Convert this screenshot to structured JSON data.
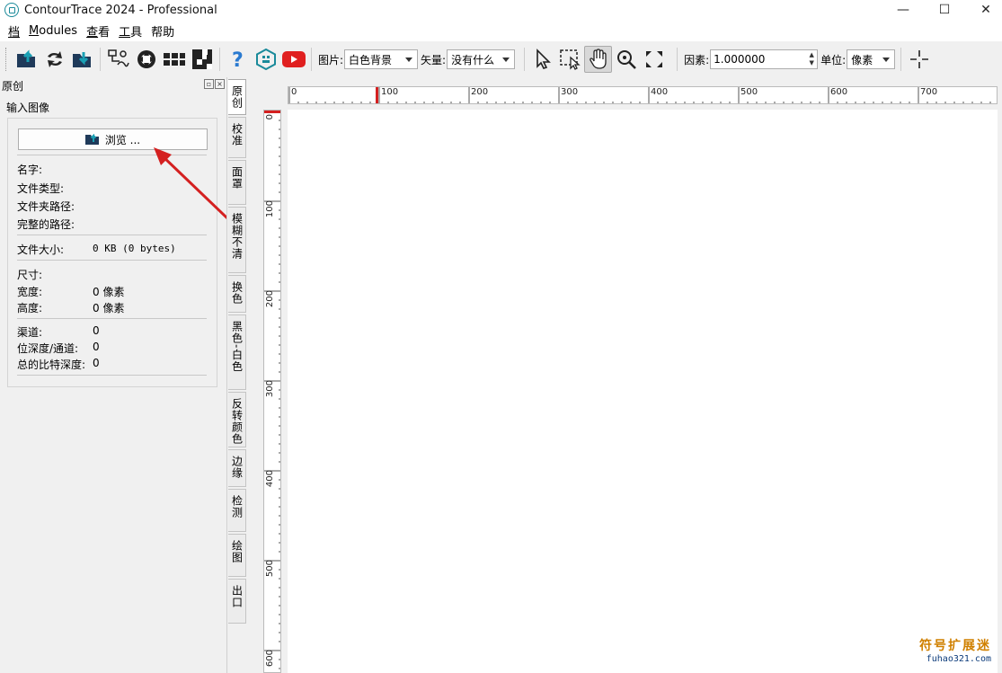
{
  "window": {
    "title": "ContourTrace 2024 - Professional",
    "controls": {
      "minimize": "—",
      "maximize": "☐",
      "close": "✕"
    }
  },
  "menu": [
    {
      "label": "档",
      "underline": "档",
      "rest": ""
    },
    {
      "label": "Modules",
      "underline": "M",
      "rest": "odules"
    },
    {
      "label": "查看",
      "underline": "查",
      "rest": "看"
    },
    {
      "label": "工具",
      "underline": "工",
      "rest": "具"
    },
    {
      "label": "帮助",
      "underline": "",
      "rest": "帮助"
    }
  ],
  "toolbar": {
    "icons": [
      "open-file-icon",
      "refresh-icon",
      "save-file-icon",
      "trace-icon",
      "circle-icon",
      "grid-icon",
      "checker-icon",
      "help-icon",
      "logo-icon",
      "youtube-icon"
    ],
    "image_label": "图片:",
    "image_value": "白色背景",
    "vector_label": "矢量:",
    "vector_value": "没有什么",
    "tools": [
      "pointer-icon",
      "select-region-icon",
      "hand-icon",
      "zoom-icon",
      "fit-icon"
    ],
    "factor_label": "因素:",
    "factor_value": "1.000000",
    "unit_label": "单位:",
    "unit_value": "像素",
    "crosshair": "crosshair-icon"
  },
  "panel": {
    "header": "原创",
    "section": "输入图像",
    "browse_label": "浏览 ...",
    "name_label": "名字:",
    "filetype_label": "文件类型:",
    "folder_label": "文件夹路径:",
    "fullpath_label": "完整的路径:",
    "filesize_label": "文件大小:",
    "filesize_value": "0 KB (0 bytes)",
    "size_label": "尺寸:",
    "width_label": "宽度:",
    "width_value": "0 像素",
    "height_label": "高度:",
    "height_value": "0 像素",
    "channels_label": "渠道:",
    "channels_value": "0",
    "bitdepth_label": "位深度/通道:",
    "bitdepth_value": "0",
    "totalbits_label": "总的比特深度:",
    "totalbits_value": "0"
  },
  "tabs": [
    "原创",
    "校准",
    "面罩",
    "模糊不清",
    "换色",
    "黑色-白色",
    "反转颜色",
    "边缘",
    "检测",
    "绘图",
    "出口"
  ],
  "ruler": {
    "h_labels": [
      "0",
      "100",
      "200",
      "300",
      "400",
      "500",
      "600",
      "700"
    ],
    "v_labels": [
      "0",
      "100",
      "200",
      "300",
      "400",
      "500",
      "600"
    ]
  },
  "watermark": {
    "line1": "符号扩展迷",
    "line2": "fuhao321.com"
  },
  "colors": {
    "accent_teal": "#1a8a9a",
    "arrow_red": "#d42020",
    "youtube_red": "#e02020",
    "help_blue": "#2a7ad0"
  }
}
